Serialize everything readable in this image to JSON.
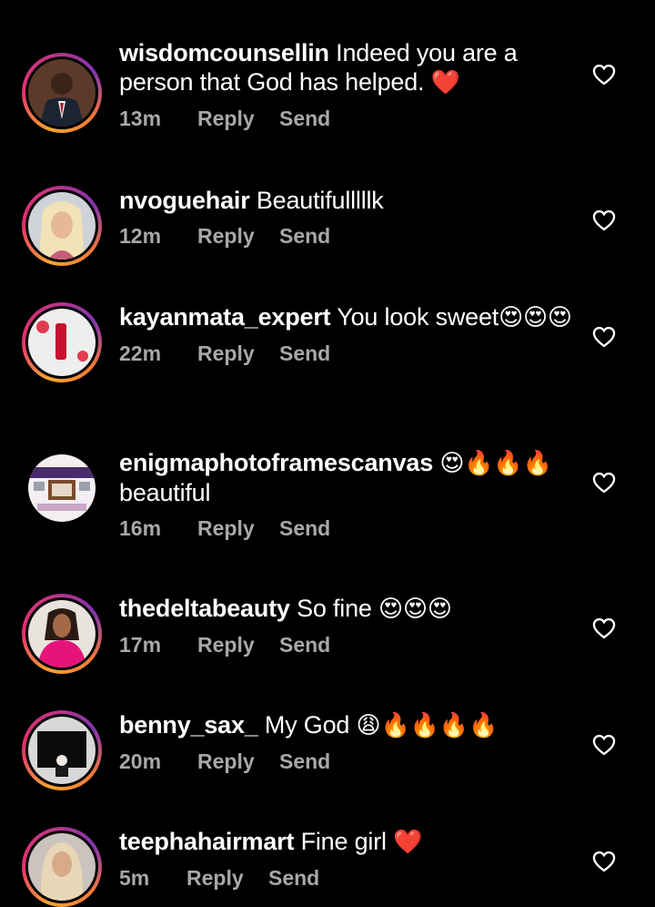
{
  "actions": {
    "reply": "Reply",
    "send": "Send"
  },
  "colors": {
    "meta": "#a8a8a8",
    "heart_red": "#e0102a"
  },
  "comments": [
    {
      "username": "wisdomcounsellin",
      "text": "Indeed you are a person that God has helped.",
      "emoji": "❤️",
      "time": "13m"
    },
    {
      "username": "nvoguehair",
      "text": "Beautifulllllk",
      "emoji": "",
      "time": "12m"
    },
    {
      "username": "kayanmata_expert",
      "text": "You look sweet",
      "emoji": "😍😍😍",
      "time": "22m"
    },
    {
      "username": "enigmaphotoframescanvas",
      "text": "beautiful",
      "emoji": "😍🔥🔥🔥",
      "time": "16m"
    },
    {
      "username": "thedeltabeauty",
      "text": "So fine",
      "emoji": "😍😍😍",
      "time": "17m"
    },
    {
      "username": "benny_sax_",
      "text": "My God",
      "emoji": "😩🔥🔥🔥🔥",
      "time": "20m"
    },
    {
      "username": "teephahairmart",
      "text": "Fine girl",
      "emoji": "❤️",
      "time": "5m"
    }
  ]
}
